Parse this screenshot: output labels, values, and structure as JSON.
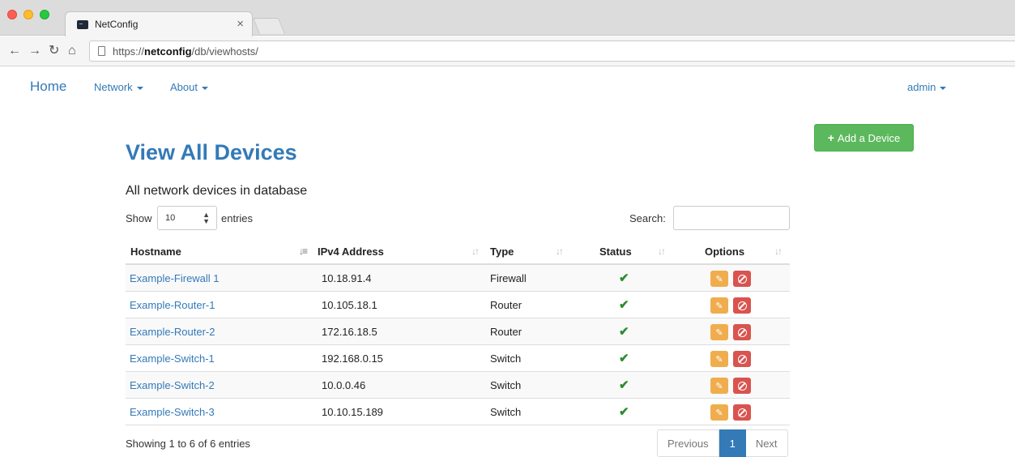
{
  "browser": {
    "tab_title": "NetConfig",
    "tab_close": "×",
    "url_prefix": "https://",
    "url_host": "netconfig",
    "url_path": "/db/viewhosts/"
  },
  "navbar": {
    "brand": "Home",
    "menu_network": "Network",
    "menu_about": "About",
    "user_menu": "admin"
  },
  "page": {
    "add_button_label": "Add a Device",
    "title": "View All Devices",
    "subtitle": "All network devices in database"
  },
  "table_controls": {
    "show_label": "Show",
    "page_size": "10",
    "entries_label": "entries",
    "search_label": "Search:",
    "search_value": ""
  },
  "table": {
    "columns": [
      "Hostname",
      "IPv4 Address",
      "Type",
      "Status",
      "Options"
    ],
    "sorted_column": "Hostname",
    "rows": [
      {
        "hostname": "Example-Firewall 1",
        "ipv4": "10.18.91.4",
        "type": "Firewall",
        "status": "✔"
      },
      {
        "hostname": "Example-Router-1",
        "ipv4": "10.105.18.1",
        "type": "Router",
        "status": "✔"
      },
      {
        "hostname": "Example-Router-2",
        "ipv4": "172.16.18.5",
        "type": "Router",
        "status": "✔"
      },
      {
        "hostname": "Example-Switch-1",
        "ipv4": "192.168.0.15",
        "type": "Switch",
        "status": "✔"
      },
      {
        "hostname": "Example-Switch-2",
        "ipv4": "10.0.0.46",
        "type": "Switch",
        "status": "✔"
      },
      {
        "hostname": "Example-Switch-3",
        "ipv4": "10.10.15.189",
        "type": "Switch",
        "status": "✔"
      }
    ]
  },
  "footer": {
    "info": "Showing 1 to 6 of 6 entries",
    "prev_label": "Previous",
    "current_page": "1",
    "next_label": "Next"
  },
  "colors": {
    "link": "#337ab7",
    "success": "#5cb85c",
    "edit": "#f0ad4e",
    "delete": "#d9534f",
    "status_ok": "#2e8b2e"
  }
}
